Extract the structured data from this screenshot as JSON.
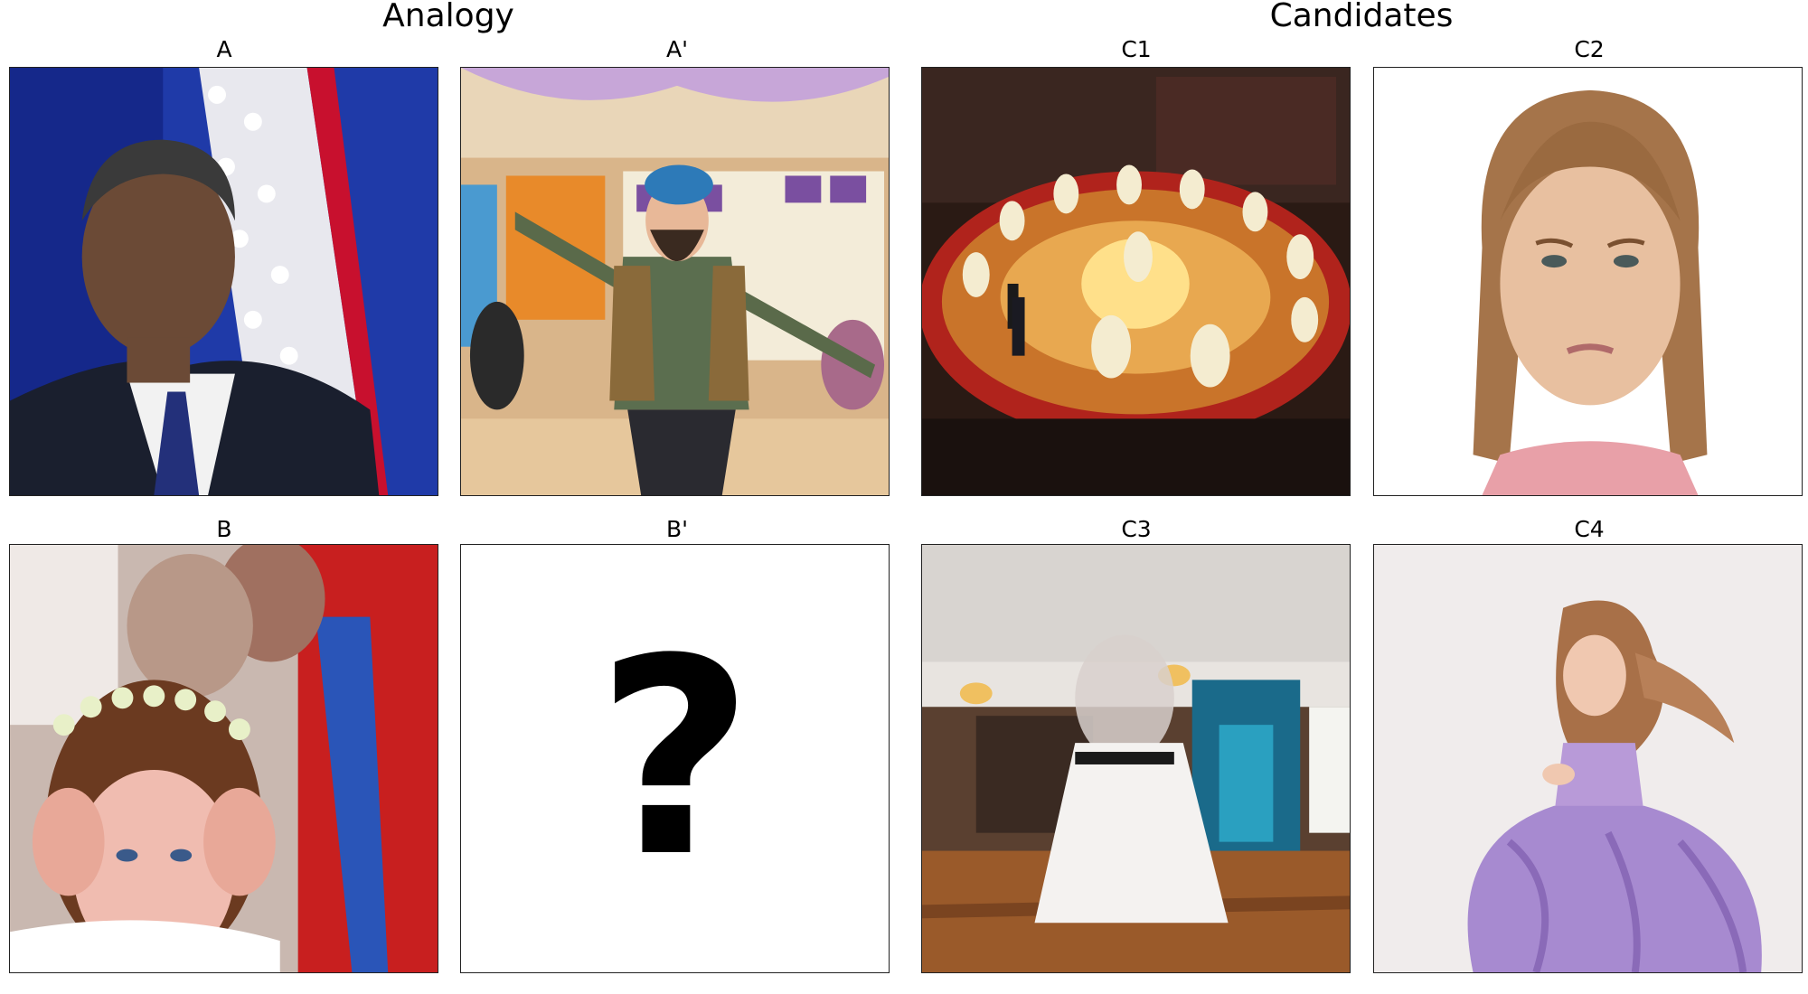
{
  "headers": {
    "analogy": "Analogy",
    "candidates": "Candidates"
  },
  "panels": {
    "A": {
      "label": "A"
    },
    "A_prime": {
      "label": "A'"
    },
    "B": {
      "label": "B"
    },
    "B_prime": {
      "label": "B'",
      "placeholder": "?"
    },
    "C1": {
      "label": "C1"
    },
    "C2": {
      "label": "C2"
    },
    "C3": {
      "label": "C3"
    },
    "C4": {
      "label": "C4"
    }
  }
}
